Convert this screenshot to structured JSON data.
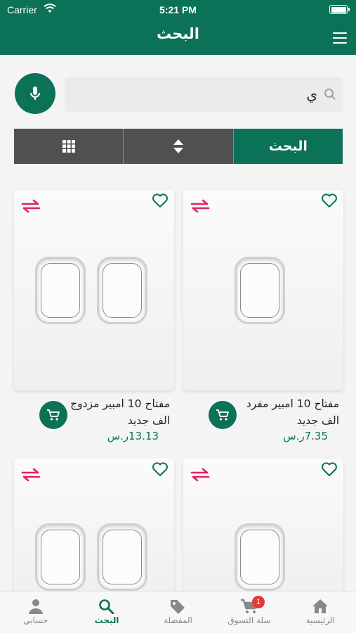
{
  "status_bar": {
    "carrier": "Carrier",
    "time": "5:21 PM"
  },
  "header": {
    "title": "البحث"
  },
  "search": {
    "value": "ي",
    "placeholder": ""
  },
  "toolbar": {
    "search_label": "البحث"
  },
  "products": [
    {
      "name": "مفتاح 10 امبير مفرد الف جديد",
      "price": "7.35ر.س",
      "gang": 1
    },
    {
      "name": "مفتاح 10 امبير مزدوج الف جديد",
      "price": "13.13ر.س",
      "gang": 2
    },
    {
      "gang": 1
    },
    {
      "gang": 2
    }
  ],
  "tabs": [
    {
      "label": "الرئيسية",
      "icon": "home-icon"
    },
    {
      "label": "سلة التسوق",
      "icon": "cart-icon",
      "badge": "1"
    },
    {
      "label": "المفضلة",
      "icon": "tag-icon"
    },
    {
      "label": "البحث",
      "icon": "search-icon",
      "active": true
    },
    {
      "label": "حسابي",
      "icon": "person-icon"
    }
  ],
  "colors": {
    "primary": "#0b7257",
    "toolbar_dark": "#505050",
    "accent_swap": "#e0245e",
    "badge": "#e53935"
  }
}
